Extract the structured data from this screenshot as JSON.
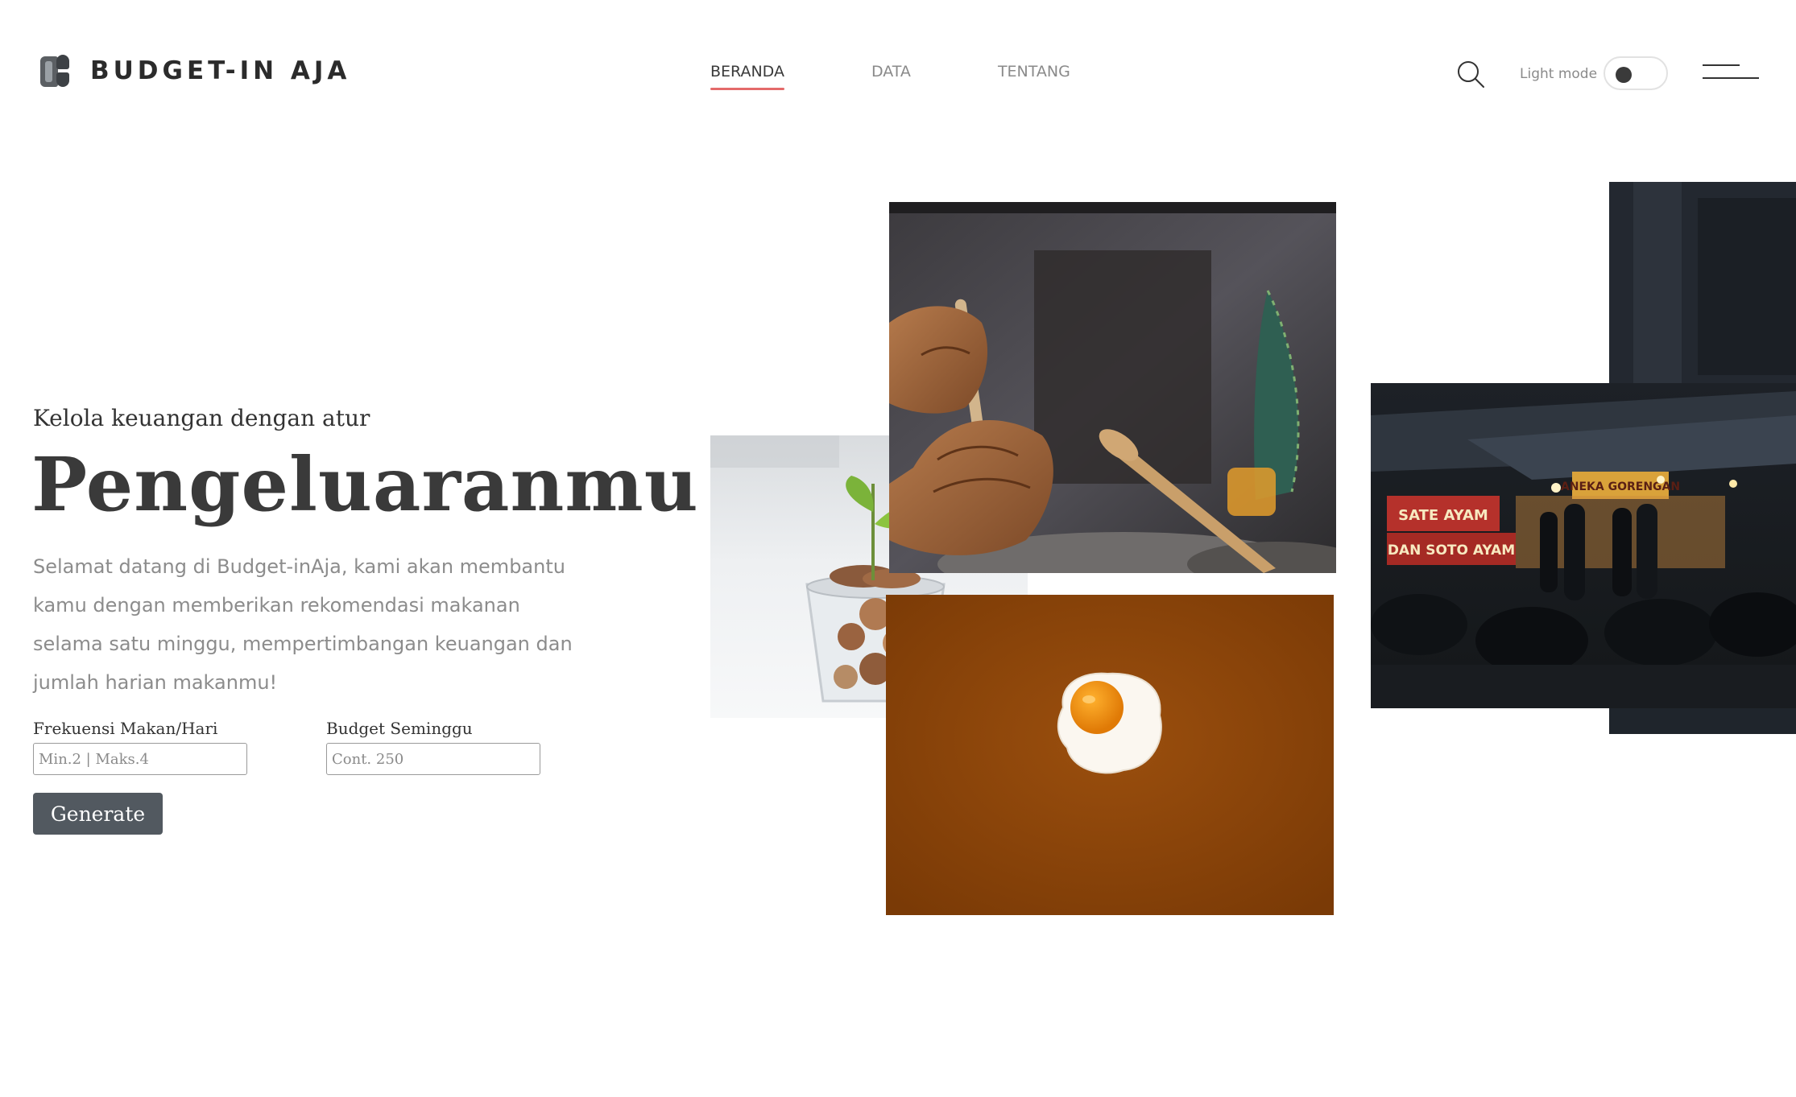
{
  "header": {
    "logo_text": "BUDGET-IN AJA",
    "nav": [
      {
        "label": "BERANDA",
        "active": true
      },
      {
        "label": "DATA",
        "active": false
      },
      {
        "label": "TENTANG",
        "active": false
      }
    ],
    "mode_label": "Light mode",
    "icons": {
      "logo": "budget-logo-icon",
      "search": "search-icon",
      "menu": "hamburger-menu-icon"
    }
  },
  "hero": {
    "eyebrow": "Kelola keuangan dengan atur",
    "title": "Pengeluaranmu",
    "description": "Selamat datang di Budget-inAja, kami akan membantu kamu dengan memberikan rekomendasi makanan selama satu minggu, mempertimbangan keuangan dan jumlah harian makanmu!"
  },
  "form": {
    "frequency_label": "Frekuensi Makan/Hari",
    "frequency_placeholder": "Min.2 | Maks.4",
    "budget_label": "Budget Seminggu",
    "budget_placeholder": "Cont. 250",
    "generate_label": "Generate"
  },
  "images": {
    "sign_top": "SATE AYAM",
    "sign_bottom": "DAN SOTO AYAM",
    "sign_right": "ANEKA GORENGAN"
  },
  "colors": {
    "accent": "#e46a6a",
    "button": "#525960",
    "text_dark": "#3a3a3a",
    "text_muted": "#8c8c8c"
  }
}
